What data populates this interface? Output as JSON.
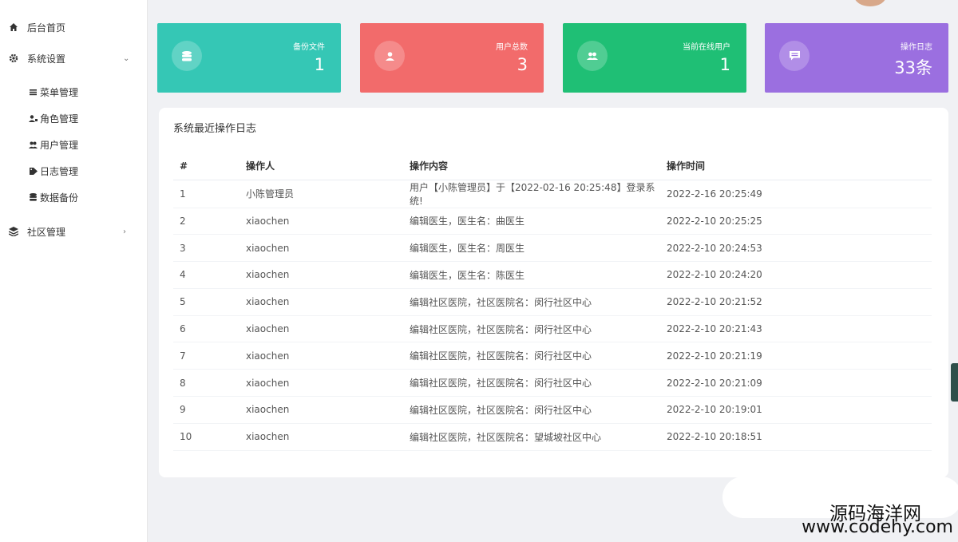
{
  "sidebar": {
    "items": [
      {
        "label": "后台首页",
        "icon": "home-icon"
      },
      {
        "label": "系统设置",
        "icon": "gear-icon",
        "arrow": "⌄"
      },
      {
        "label": "社区管理",
        "icon": "layers-icon",
        "arrow": "›"
      }
    ],
    "sub_items": [
      {
        "label": "菜单管理",
        "icon": "list-icon"
      },
      {
        "label": "角色管理",
        "icon": "user-role-icon"
      },
      {
        "label": "用户管理",
        "icon": "users-icon"
      },
      {
        "label": "日志管理",
        "icon": "tag-icon"
      },
      {
        "label": "数据备份",
        "icon": "database-icon"
      }
    ]
  },
  "cards": [
    {
      "title": "备份文件",
      "value": "1",
      "color": "#35c7b5",
      "icon": "database-icon"
    },
    {
      "title": "用户总数",
      "value": "3",
      "color": "#f26b6b",
      "icon": "user-icon"
    },
    {
      "title": "当前在线用户",
      "value": "1",
      "color": "#1fbf75",
      "icon": "users-icon"
    },
    {
      "title": "操作日志",
      "value": "33条",
      "color": "#9b6fe0",
      "icon": "message-icon"
    }
  ],
  "log": {
    "title": "系统最近操作日志",
    "headers": [
      "#",
      "操作人",
      "操作内容",
      "操作时间"
    ],
    "rows": [
      [
        "1",
        "小陈管理员",
        "用户【小陈管理员】于【2022-02-16 20:25:48】登录系统!",
        "2022-2-16 20:25:49"
      ],
      [
        "2",
        "xiaochen",
        "编辑医生，医生名：曲医生",
        "2022-2-10 20:25:25"
      ],
      [
        "3",
        "xiaochen",
        "编辑医生，医生名：周医生",
        "2022-2-10 20:24:53"
      ],
      [
        "4",
        "xiaochen",
        "编辑医生，医生名：陈医生",
        "2022-2-10 20:24:20"
      ],
      [
        "5",
        "xiaochen",
        "编辑社区医院，社区医院名：闵行社区中心",
        "2022-2-10 20:21:52"
      ],
      [
        "6",
        "xiaochen",
        "编辑社区医院，社区医院名：闵行社区中心",
        "2022-2-10 20:21:43"
      ],
      [
        "7",
        "xiaochen",
        "编辑社区医院，社区医院名：闵行社区中心",
        "2022-2-10 20:21:19"
      ],
      [
        "8",
        "xiaochen",
        "编辑社区医院，社区医院名：闵行社区中心",
        "2022-2-10 20:21:09"
      ],
      [
        "9",
        "xiaochen",
        "编辑社区医院，社区医院名：闵行社区中心",
        "2022-2-10 20:19:01"
      ],
      [
        "10",
        "xiaochen",
        "编辑社区医院，社区医院名：望城坡社区中心",
        "2022-2-10 20:18:51"
      ]
    ]
  },
  "watermark": {
    "cn": "源码海洋网",
    "en": "www.codehy.com"
  }
}
